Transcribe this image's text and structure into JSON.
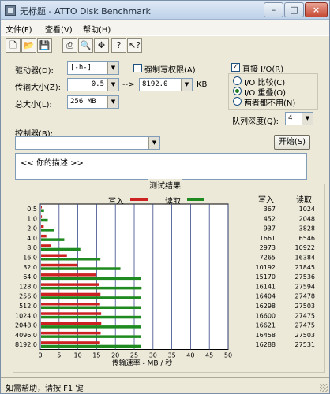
{
  "window": {
    "title": "无标题 - ATTO Disk Benchmark",
    "min_glyph": "–",
    "max_glyph": "□",
    "close_glyph": "×"
  },
  "menu": {
    "file": "文件(F)",
    "view": "查看(V)",
    "help": "帮助(H)"
  },
  "toolbar": {
    "buttons": [
      {
        "icon": "new-document-icon",
        "glyph": "🗋"
      },
      {
        "icon": "open-folder-icon",
        "glyph": "📂"
      },
      {
        "icon": "save-disk-icon",
        "glyph": "💾"
      },
      {
        "icon": "print-icon",
        "glyph": "⎙"
      },
      {
        "icon": "print-preview-icon",
        "glyph": "🔍"
      },
      {
        "icon": "move-icon",
        "glyph": "✥"
      },
      {
        "icon": "help-question-icon",
        "glyph": "?"
      },
      {
        "icon": "context-help-icon",
        "glyph": "↖?"
      }
    ]
  },
  "form": {
    "drive_label": "驱动器(D):",
    "drive_value": "[-h-]",
    "force_write_label": "强制写权限(A)",
    "force_write_checked": false,
    "transfer_size_label": "传输大小(Z):",
    "transfer_from": "0.5",
    "transfer_arrow": "-->",
    "transfer_to": "8192.0",
    "transfer_unit": "KB",
    "total_size_label": "总大小(L):",
    "total_size_value": "256 MB",
    "direct_io_label": "直接 I/O(R)",
    "direct_io_checked": true,
    "io_compare_label": "I/O 比较(C)",
    "io_overlap_label": "I/O 重叠(O)",
    "io_neither_label": "两者都不用(N)",
    "io_mode_selected": "I/O 重叠(O)",
    "queue_depth_label": "队列深度(Q):",
    "queue_depth_value": "4",
    "controller_label": "控制器(B):",
    "controller_value": "",
    "start_button": "开始(S)",
    "description": "<<    你的描述    >>"
  },
  "results": {
    "title": "测试结果",
    "write_legend": "写入",
    "read_legend": "读取",
    "col_write": "写入",
    "col_read": "读取",
    "write_color": "#cc2222",
    "read_color": "#1f8a1f"
  },
  "chart_data": {
    "type": "bar",
    "orientation": "horizontal",
    "categories": [
      "0.5",
      "1.0",
      "2.0",
      "4.0",
      "8.0",
      "16.0",
      "32.0",
      "64.0",
      "128.0",
      "256.0",
      "512.0",
      "1024.0",
      "2048.0",
      "4096.0",
      "8192.0"
    ],
    "series": [
      {
        "name": "写入",
        "values": [
          367,
          452,
          937,
          1661,
          2973,
          7265,
          10192,
          15170,
          16141,
          16404,
          16298,
          16600,
          16621,
          16458,
          16288
        ]
      },
      {
        "name": "读取",
        "values": [
          1024,
          2048,
          3828,
          6546,
          10922,
          16384,
          21845,
          27536,
          27594,
          27478,
          27503,
          27475,
          27475,
          27503,
          27531
        ]
      }
    ],
    "x_ticks": [
      "0",
      "5",
      "10",
      "15",
      "20",
      "25",
      "30",
      "35",
      "40",
      "45",
      "50"
    ],
    "xlim": [
      0,
      50
    ],
    "xlabel": "传输速率 - MB / 秒",
    "grid": true
  },
  "status": {
    "text": "如需帮助，请按 F1 键"
  }
}
